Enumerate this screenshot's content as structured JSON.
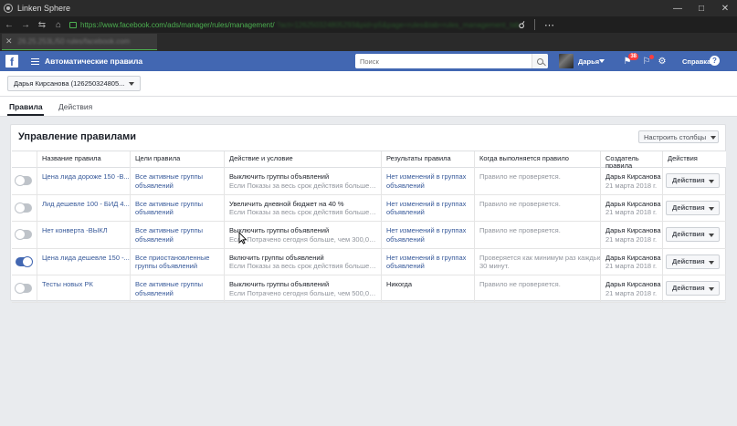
{
  "browser": {
    "title": "Linken Sphere",
    "url_visible": "https://www.facebook.com/ads/manager/rules/management/",
    "url_rest": "?act=126250324805293&pid=p5&page=rules&tab=rules_management_tab",
    "tab_label": "26.25.253L/50 rules/facebook.com"
  },
  "fb": {
    "page_name": "Автоматические правила",
    "search_placeholder": "Поиск",
    "user_name": "Дарья",
    "notif_count": "38",
    "help_label": "Справка",
    "help_icon_char": "?"
  },
  "account": {
    "selected": "Дарья Кирсанова (126250324805..."
  },
  "tabs": [
    {
      "label": "Правила",
      "active": true
    },
    {
      "label": "Действия",
      "active": false
    }
  ],
  "card": {
    "title": "Управление правилами",
    "columns_button": "Настроить столбцы"
  },
  "table": {
    "headers": [
      "",
      "Название правила",
      "Цели правила",
      "Действие и условие",
      "Результаты правила",
      "Когда выполняется правило",
      "Создатель правила",
      "Действия"
    ],
    "rows": [
      {
        "enabled": false,
        "name": "Цена лида дороже 150 -В...",
        "target_1": "Все активные группы",
        "target_2": "объявлений",
        "action": "Выключить группы объявлений",
        "condition": "Если Показы за весь срок действия больше, ч...",
        "result_1": "Нет изменений в группах",
        "result_2": "объявлений",
        "when_1": "Правило не проверяется.",
        "when_2": "",
        "creator": "Дарья Кирсанова",
        "date": "21 марта 2018 г.",
        "actions": "Действия"
      },
      {
        "enabled": false,
        "name": "Лид дешевле 100 - БИД 4...",
        "target_1": "Все активные группы",
        "target_2": "объявлений",
        "action": "Увеличить дневной бюджет на 40 %",
        "condition": "Если Показы за весь срок действия больше, ч...",
        "result_1": "Нет изменений в группах",
        "result_2": "объявлений",
        "when_1": "Правило не проверяется.",
        "when_2": "",
        "creator": "Дарья Кирсанова",
        "date": "21 марта 2018 г.",
        "actions": "Действия"
      },
      {
        "enabled": false,
        "name": "Нет конверта -ВЫКЛ",
        "target_1": "Все активные группы",
        "target_2": "объявлений",
        "action": "Выключить группы объявлений",
        "condition": "Если Потрачено сегодня больше, чем 300,00 р...",
        "result_1": "Нет изменений в группах",
        "result_2": "объявлений",
        "when_1": "Правило не проверяется.",
        "when_2": "",
        "creator": "Дарья Кирсанова",
        "date": "21 марта 2018 г.",
        "actions": "Действия"
      },
      {
        "enabled": true,
        "name": "Цена лида дешевле 150 -...",
        "target_1": "Все приостановленные",
        "target_2": "группы объявлений",
        "action": "Включить группы объявлений",
        "condition": "Если Показы за весь срок действия больше, ч...",
        "result_1": "Нет изменений в группах",
        "result_2": "объявлений",
        "when_1": "Проверяется как минимум раз каждые",
        "when_2": "30 минут.",
        "creator": "Дарья Кирсанова",
        "date": "21 марта 2018 г.",
        "actions": "Действия"
      },
      {
        "enabled": false,
        "name": "Тесты новых РК",
        "target_1": "Все активные группы",
        "target_2": "объявлений",
        "action": "Выключить группы объявлений",
        "condition": "Если Потрачено сегодня больше, чем 500,00 р...",
        "result_1": "Никогда",
        "result_2": "",
        "when_1": "Правило не проверяется.",
        "when_2": "",
        "creator": "Дарья Кирсанова",
        "date": "21 марта 2018 г.",
        "actions": "Действия"
      }
    ]
  }
}
